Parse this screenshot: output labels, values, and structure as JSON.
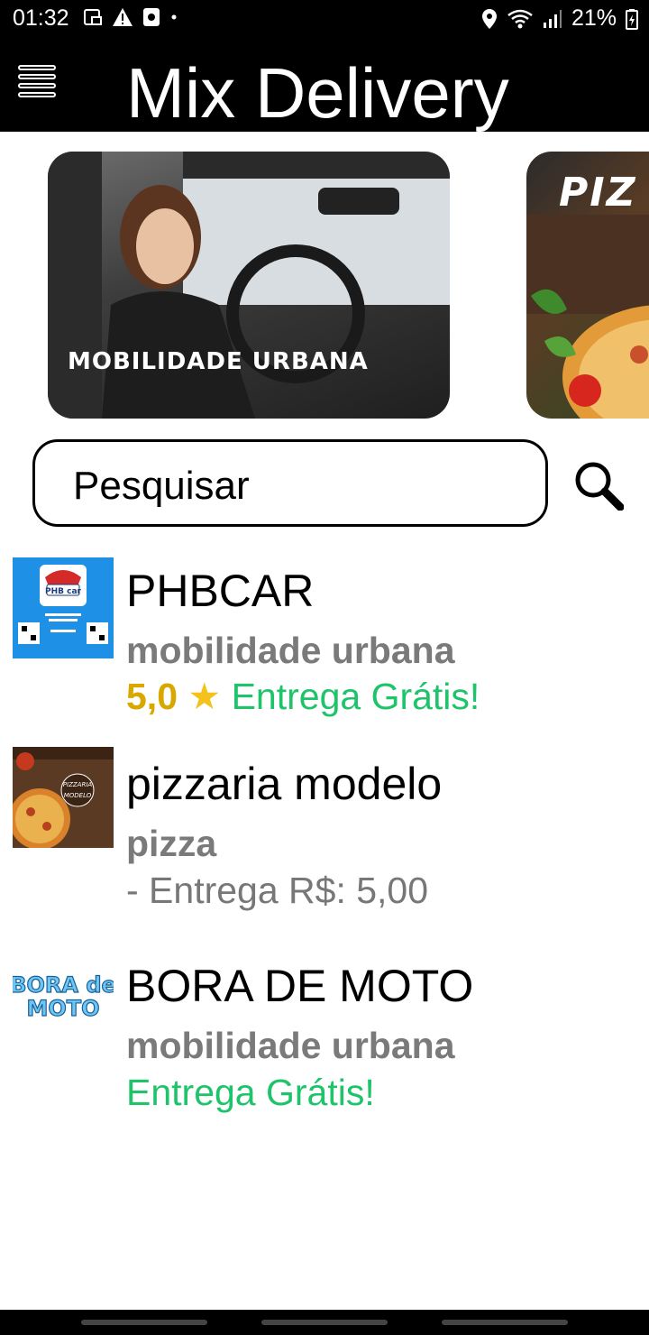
{
  "status_bar": {
    "time": "01:32",
    "battery": "21%",
    "icons": [
      "screenshot-icon",
      "alert-icon",
      "media-icon",
      "dot-icon",
      "location-icon",
      "wifi-icon",
      "signal-icon",
      "battery-icon"
    ]
  },
  "header": {
    "title": "Mix Delivery",
    "menu_icon": "hamburger-menu-icon"
  },
  "banners": [
    {
      "label": "MOBILIDADE URBANA"
    },
    {
      "label": "PIZ"
    }
  ],
  "search": {
    "placeholder": "Pesquisar",
    "icon": "search-icon"
  },
  "stores": [
    {
      "name": "PHBCAR",
      "category": "mobilidade urbana",
      "rating": "5,0",
      "delivery": "Entrega Grátis!",
      "logo_text": "PHB car"
    },
    {
      "name": "pizzaria modelo",
      "category": "pizza",
      "delivery": "- Entrega R$: 5,00",
      "logo_text": "PIZZARIA MODELO"
    },
    {
      "name": "BORA DE MOTO",
      "category": "mobilidade urbana",
      "delivery": "Entrega Grátis!",
      "logo_text": "BORA de MOTO"
    }
  ],
  "colors": {
    "header_bg": "#000000",
    "rating": "#d9a800",
    "free_delivery": "#1ec46a",
    "category": "#7a7a7a"
  }
}
